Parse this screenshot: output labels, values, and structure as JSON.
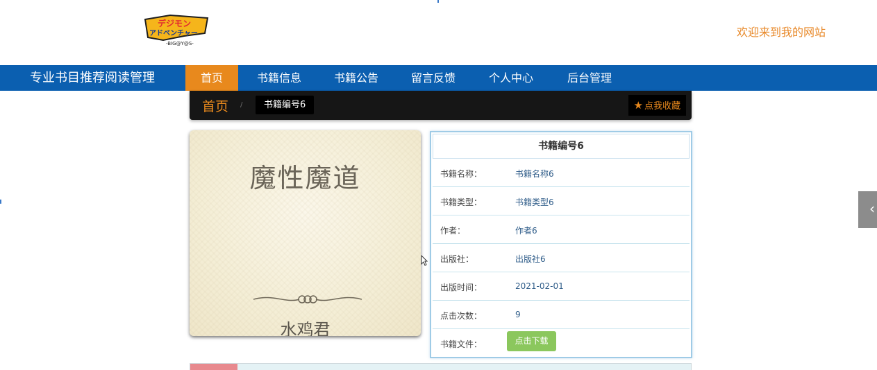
{
  "header": {
    "logo_text": "デジモン\nアドベンチャー\n-BIG@Y@S-",
    "welcome": "欢迎来到我的网站"
  },
  "nav": {
    "site_title": "专业书目推荐阅读管理",
    "items": [
      {
        "label": "首页",
        "active": true
      },
      {
        "label": "书籍信息",
        "active": false
      },
      {
        "label": "书籍公告",
        "active": false
      },
      {
        "label": "留言反馈",
        "active": false
      },
      {
        "label": "个人中心",
        "active": false
      },
      {
        "label": "后台管理",
        "active": false
      }
    ]
  },
  "breadcrumb": {
    "home": "首页",
    "separator": "/",
    "current": "书籍编号6",
    "favorite": "点我收藏"
  },
  "cover": {
    "title": "魔性魔道",
    "author": "水鸡君"
  },
  "detail": {
    "heading": "书籍编号6",
    "rows": [
      {
        "label": "书籍名称：",
        "value": "书籍名称6"
      },
      {
        "label": "书籍类型：",
        "value": "书籍类型6"
      },
      {
        "label": "作者：",
        "value": "作者6"
      },
      {
        "label": "出版社：",
        "value": "出版社6"
      },
      {
        "label": "出版时间：",
        "value": "2021-02-01"
      },
      {
        "label": "点击次数：",
        "value": "9"
      },
      {
        "label": "书籍文件：",
        "value": ""
      }
    ],
    "download_label": "点击下载"
  },
  "side_tab": {
    "icon": "chevron-left-icon",
    "glyph": "‹"
  },
  "colors": {
    "nav_bg": "#0b5fb0",
    "accent": "#e8891d",
    "button_green": "#8bc75d"
  }
}
